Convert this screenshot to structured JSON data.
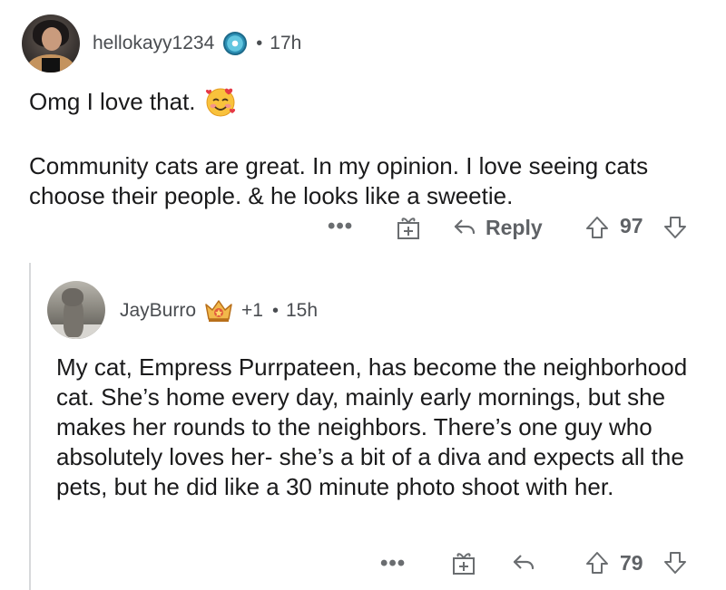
{
  "comments": [
    {
      "username": "hellokayy1234",
      "time": "17h",
      "separator": "•",
      "line1": "Omg I love that.",
      "body": "Community cats are great. In my opinion. I love seeing cats choose their people. & he looks like a sweetie.",
      "actions": {
        "more": "•••",
        "reply": "Reply",
        "score": "97"
      },
      "avatar_icon": "user-avatar-photo",
      "badge_icon": "verified-badge-icon",
      "emoji_icon": "smiling-face-with-hearts-icon"
    },
    {
      "username": "JayBurro",
      "karma": "+1",
      "time": "15h",
      "separator": "•",
      "body": "My cat, Empress Purrpateen, has become the neighborhood cat. She’s home every day, mainly early mornings, but she makes her rounds to the neighbors. There’s one guy who absolutely loves her- she’s a bit of a diva and expects all the pets, but he did like a 30 minute photo shoot with her.",
      "actions": {
        "more": "•••",
        "score": "79"
      },
      "avatar_icon": "cat-avatar-photo",
      "badge_icon": "award-flair-icon"
    }
  ],
  "colors": {
    "text": "#1a1a1b",
    "meta": "#4a4d51",
    "action": "#6a6d70",
    "thread": "#d7d9db"
  }
}
